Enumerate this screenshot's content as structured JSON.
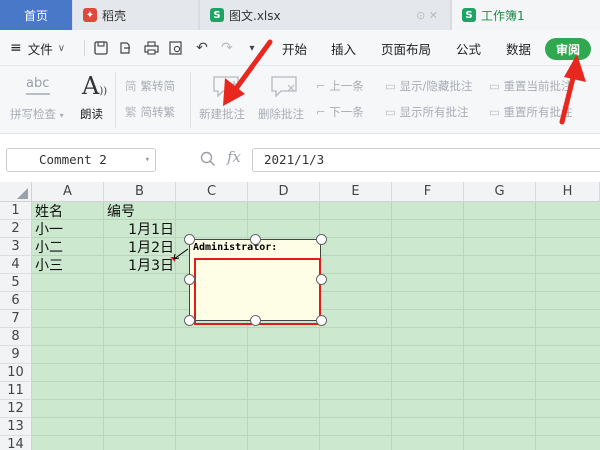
{
  "tabs": {
    "home": "首页",
    "docer": "稻壳",
    "file": "图文.xlsx",
    "workbook": "工作簿1"
  },
  "menu": {
    "file_label": "文件",
    "items": [
      "开始",
      "插入",
      "页面布局",
      "公式",
      "数据"
    ],
    "review": "审阅"
  },
  "ribbon": {
    "spellcheck_icon": "abc",
    "spellcheck": "拼写检查",
    "read_icon": "A",
    "read_aloud": "朗读",
    "trad_icon": "简",
    "to_trad": "繁转简",
    "simp_icon": "繁",
    "to_simp": "简转繁",
    "new_comment": "新建批注",
    "delete_comment": "删除批注",
    "prev": "上一条",
    "next": "下一条",
    "show_hide": "显示/隐藏批注",
    "show_all": "显示所有批注",
    "reset_current": "重置当前批注",
    "reset_all": "重置所有批注"
  },
  "formula_bar": {
    "name_box": "Comment 2",
    "fx": "fx",
    "value": "2021/1/3"
  },
  "columns": [
    "A",
    "B",
    "C",
    "D",
    "E",
    "F",
    "G",
    "H"
  ],
  "rows": [
    "1",
    "2",
    "3",
    "4",
    "5",
    "6",
    "7",
    "8",
    "9",
    "10",
    "11",
    "12",
    "13",
    "14"
  ],
  "cells": {
    "A1": "姓名",
    "B1": "编号",
    "A2": "小一",
    "B2": "1月1日",
    "A3": "小二",
    "B3": "1月2日",
    "A4": "小三",
    "B4": "1月3日"
  },
  "comment": {
    "author": "Administrator:"
  },
  "colors": {
    "accent": "#4a78c8",
    "review_pill": "#2fa84f",
    "highlight": "#e01b1b",
    "grid_fill": "#cce8cf"
  }
}
